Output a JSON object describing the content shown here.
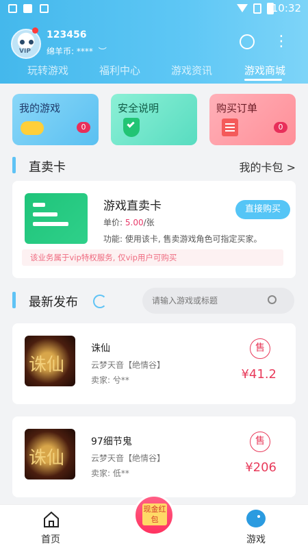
{
  "status": {
    "time": "10:32"
  },
  "profile": {
    "username": "123456",
    "coins_label": "绵羊币: ****",
    "vip": "VIP"
  },
  "tabs": [
    {
      "label": "玩转游戏"
    },
    {
      "label": "福利中心"
    },
    {
      "label": "游戏资讯"
    },
    {
      "label": "游戏商城"
    }
  ],
  "quick_cards": [
    {
      "title": "我的游戏",
      "badge": "0"
    },
    {
      "title": "安全说明"
    },
    {
      "title": "购买订单",
      "badge": "0"
    }
  ],
  "direct_section": {
    "title": "直卖卡",
    "link": "我的卡包 >"
  },
  "direct_card": {
    "title": "游戏直卖卡",
    "price_label": "单价:",
    "price_value": "5.00",
    "price_unit": "/张",
    "func": "功能: 使用该卡, 售卖游戏角色可指定买家。",
    "buy_button": "直接购买",
    "notice": "该业务属于vip特权服务, 仅vip用户可购买"
  },
  "latest_section": {
    "title": "最新发布",
    "search_placeholder": "请输入游戏或标题"
  },
  "listings": [
    {
      "game": "诛仙",
      "server": "云梦天音【绝情谷】",
      "seller": "卖家: 兮**",
      "sell_tag": "售",
      "price": "¥41.2",
      "logo_text": "诛仙"
    },
    {
      "game": "97细节鬼",
      "server": "云梦天音【绝情谷】",
      "seller": "卖家: 低**",
      "sell_tag": "售",
      "price": "¥206",
      "logo_text": "诛仙"
    }
  ],
  "bottom_nav": {
    "home": "首页",
    "center": "现金红包",
    "game": "游戏"
  },
  "colors": {
    "header": "#44b8ec",
    "accent": "#5fc3f5",
    "price": "#e83a5a"
  }
}
